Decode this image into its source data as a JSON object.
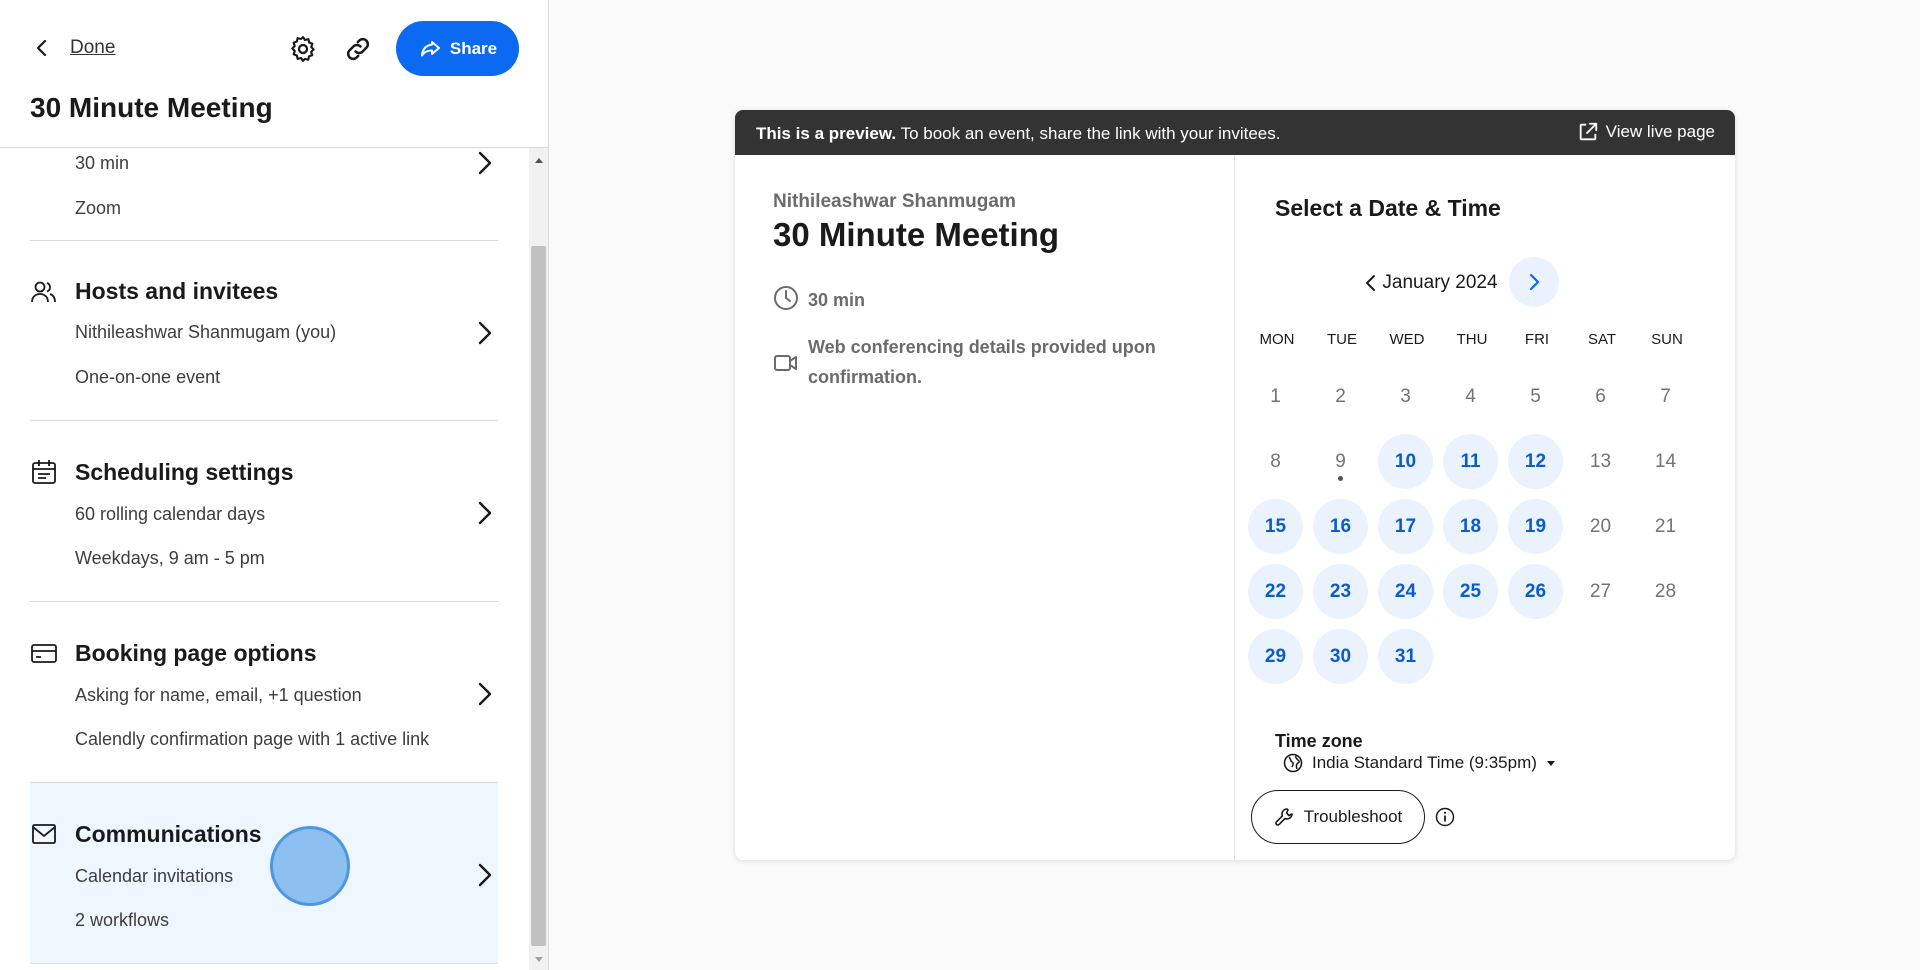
{
  "sidebar": {
    "done_label": "Done",
    "share_label": "Share",
    "event_title": "30 Minute Meeting",
    "sections": [
      {
        "title": "",
        "lines": [
          "30 min",
          "Zoom"
        ],
        "icon": ""
      },
      {
        "title": "Hosts and invitees",
        "lines": [
          "Nithileashwar Shanmugam (you)",
          "One-on-one event"
        ],
        "icon": "people-icon"
      },
      {
        "title": "Scheduling settings",
        "lines": [
          "60 rolling calendar days",
          "Weekdays, 9 am - 5 pm"
        ],
        "icon": "calendar-icon"
      },
      {
        "title": "Booking page options",
        "lines": [
          "Asking for name, email, +1 question",
          "Calendly confirmation page with 1 active link"
        ],
        "icon": "card-icon"
      },
      {
        "title": "Communications",
        "lines": [
          "Calendar invitations",
          "2 workflows"
        ],
        "icon": "mail-icon"
      }
    ],
    "active_section_bg": "#eef6ff"
  },
  "preview": {
    "banner_bold": "This is a preview.",
    "banner_text": " To book an event, share the link with your invitees.",
    "view_live_label": "View live page",
    "organizer": "Nithileashwar Shanmugam",
    "title": "30 Minute Meeting",
    "duration": "30 min",
    "conferencing": "Web conferencing details provided upon confirmation.",
    "select_title": "Select a Date & Time",
    "month_label": "January 2024",
    "weekdays": [
      "MON",
      "TUE",
      "WED",
      "THU",
      "FRI",
      "SAT",
      "SUN"
    ],
    "weeks": [
      [
        {
          "d": "1",
          "a": false
        },
        {
          "d": "2",
          "a": false
        },
        {
          "d": "3",
          "a": false
        },
        {
          "d": "4",
          "a": false
        },
        {
          "d": "5",
          "a": false
        },
        {
          "d": "6",
          "a": false
        },
        {
          "d": "7",
          "a": false
        }
      ],
      [
        {
          "d": "8",
          "a": false
        },
        {
          "d": "9",
          "a": false,
          "today": true
        },
        {
          "d": "10",
          "a": true
        },
        {
          "d": "11",
          "a": true
        },
        {
          "d": "12",
          "a": true
        },
        {
          "d": "13",
          "a": false
        },
        {
          "d": "14",
          "a": false
        }
      ],
      [
        {
          "d": "15",
          "a": true
        },
        {
          "d": "16",
          "a": true
        },
        {
          "d": "17",
          "a": true
        },
        {
          "d": "18",
          "a": true
        },
        {
          "d": "19",
          "a": true
        },
        {
          "d": "20",
          "a": false
        },
        {
          "d": "21",
          "a": false
        }
      ],
      [
        {
          "d": "22",
          "a": true
        },
        {
          "d": "23",
          "a": true
        },
        {
          "d": "24",
          "a": true
        },
        {
          "d": "25",
          "a": true
        },
        {
          "d": "26",
          "a": true
        },
        {
          "d": "27",
          "a": false
        },
        {
          "d": "28",
          "a": false
        }
      ],
      [
        {
          "d": "29",
          "a": true
        },
        {
          "d": "30",
          "a": true
        },
        {
          "d": "31",
          "a": true
        }
      ]
    ],
    "timezone_label": "Time zone",
    "timezone_value": "India Standard Time (9:35pm)",
    "troubleshoot_label": "Troubleshoot"
  },
  "colors": {
    "accent": "#0b69f2",
    "available_bg": "#eaf2fe",
    "available_text": "#0b5cc8",
    "banner_bg": "#333333"
  }
}
